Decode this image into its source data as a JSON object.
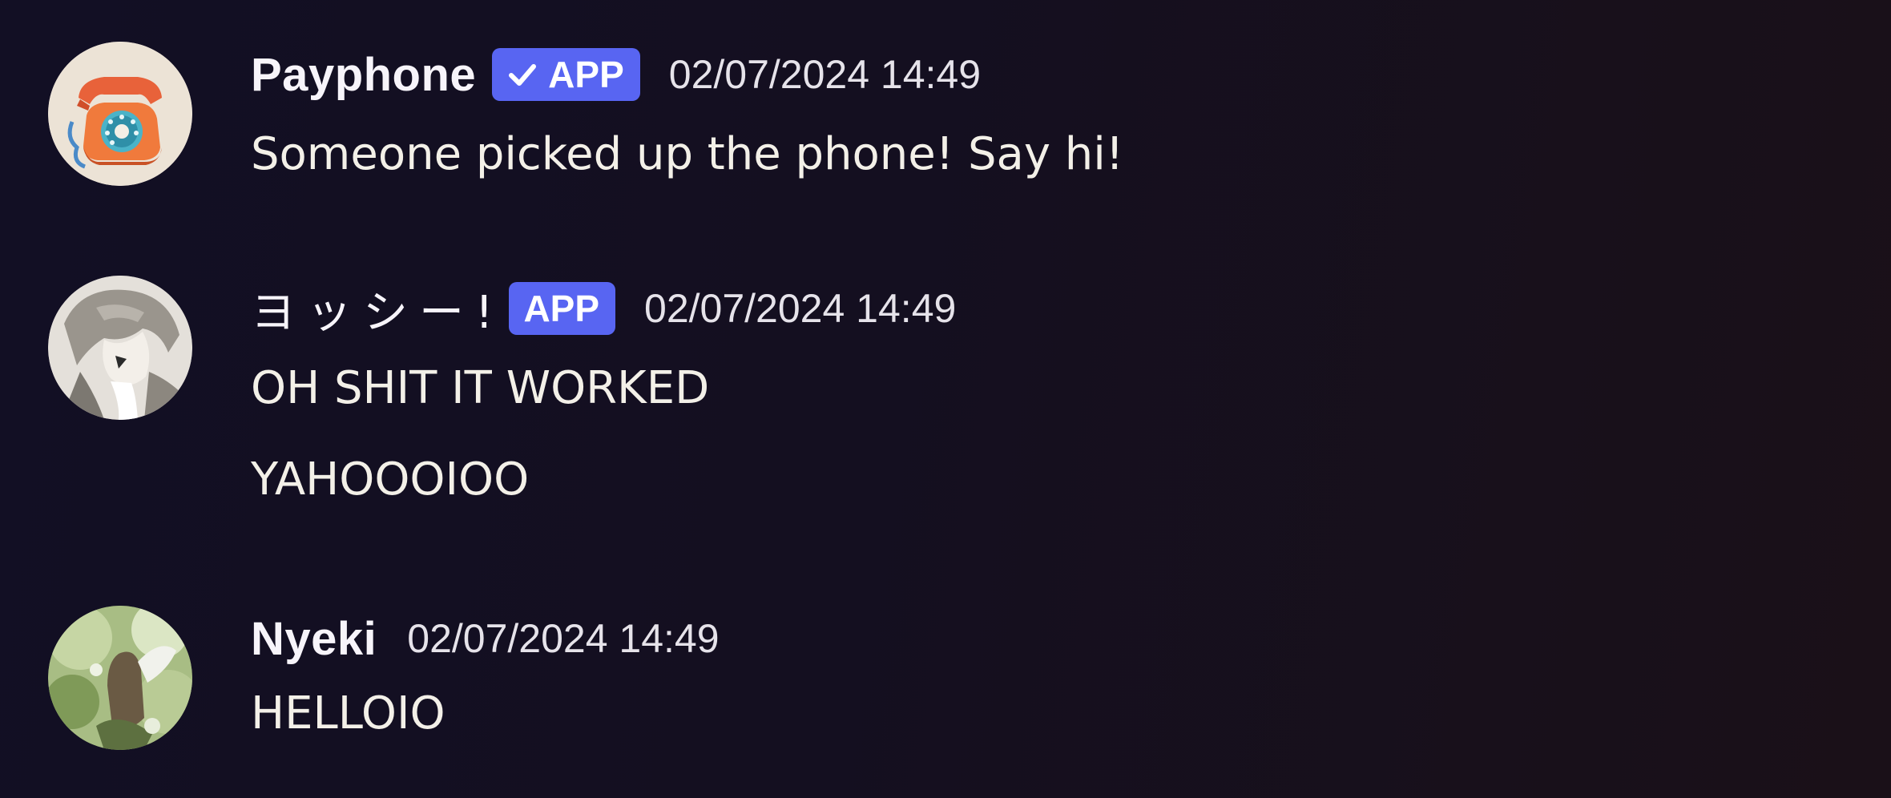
{
  "messages": [
    {
      "username": "Payphone",
      "badge": "APP",
      "badge_verified": true,
      "timestamp": "02/07/2024 14:49",
      "lines": [
        "Someone picked up the phone! Say hi!"
      ],
      "avatar_icon": "telephone-icon"
    },
    {
      "username": "ヨッシー!",
      "badge": "APP",
      "badge_verified": false,
      "timestamp": "02/07/2024 14:49",
      "lines": [
        "OH SHIT IT WORKED",
        "YAHOOOIOO"
      ],
      "avatar_icon": "anime-character-avatar"
    },
    {
      "username": "Nyeki",
      "timestamp": "02/07/2024 14:49",
      "lines": [
        "HELLOIO"
      ],
      "avatar_icon": "nature-photo-avatar"
    }
  ],
  "colors": {
    "badge": "#5865f2",
    "background": "#130f22",
    "text": "#f3f0e8"
  }
}
